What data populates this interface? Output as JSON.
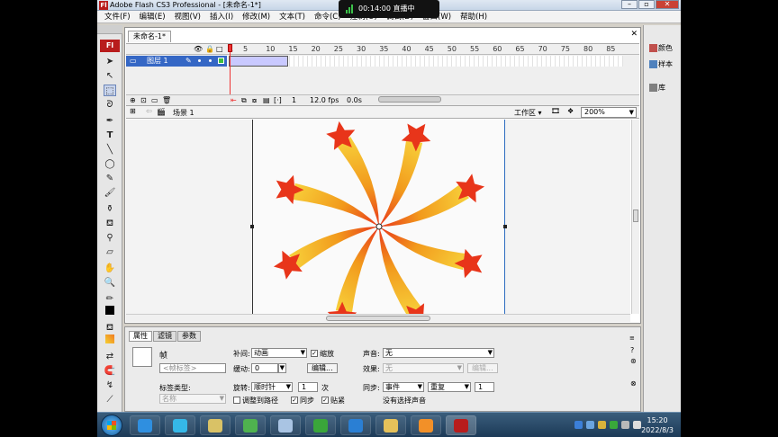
{
  "window": {
    "title": "Adobe Flash CS3 Professional - [未命名-1*]",
    "app_icon": "Fl"
  },
  "window_buttons": [
    "–",
    "▫",
    "✕"
  ],
  "live_overlay": {
    "time": "00:14:00",
    "status": "直播中",
    "accent": "#3cc24a"
  },
  "menu": [
    "文件(F)",
    "编辑(E)",
    "视图(V)",
    "插入(I)",
    "修改(M)",
    "文本(T)",
    "命令(C)",
    "控制(O)",
    "调试(D)",
    "窗口(W)",
    "帮助(H)"
  ],
  "tools": {
    "badge": "Fl"
  },
  "document": {
    "tab": "未命名-1*",
    "close": "✕",
    "timeline": {
      "frame_numbers": [
        "1",
        "5",
        "10",
        "15",
        "20",
        "25",
        "30",
        "35",
        "40",
        "45",
        "50",
        "55",
        "60",
        "65",
        "70",
        "75",
        "80",
        "85"
      ],
      "layer_name": "图层 1",
      "current_frame": "1",
      "fps": "12.0 fps",
      "time": "0.0s"
    },
    "edit_bar": {
      "scene": "场景 1",
      "workspace": "工作区",
      "zoom": "200%"
    }
  },
  "right_panels": [
    {
      "label": "颜色",
      "icon_color": "#c0504d"
    },
    {
      "label": "样本",
      "icon_color": "#4f81bd"
    },
    {
      "label": "库",
      "icon_color": "#7f7f7f"
    }
  ],
  "properties": {
    "tabs": [
      "属性",
      "滤镜",
      "参数"
    ],
    "frame_label": "帧",
    "frame_name_placeholder": "<帧标签>",
    "label_type_label": "标签类型:",
    "label_type_value": "名称",
    "tween_label": "补间:",
    "tween_value": "动画",
    "scale_label": "缩放",
    "scale_checked": true,
    "ease_label": "缓动:",
    "ease_value": "0",
    "edit_button": "编辑...",
    "rotate_label": "旋转:",
    "rotate_value": "顺时针",
    "rotate_times": "1",
    "times_unit": "次",
    "orient_label": "调整到路径",
    "orient_checked": false,
    "sync_label": "同步",
    "sync_checked": true,
    "snap_label": "贴紧",
    "snap_checked": true,
    "sound_label": "声音:",
    "sound_value": "无",
    "effect_label": "效果:",
    "effect_value": "无",
    "effect_edit_button": "编辑...",
    "sync2_label": "同步:",
    "sync_event": "事件",
    "sync_repeat": "重复",
    "repeat_count": "1",
    "no_sound_text": "没有选择声音"
  },
  "taskbar": {
    "apps": [
      {
        "name": "ie",
        "color": "#2f8fe0"
      },
      {
        "name": "ie2",
        "color": "#35b8e8"
      },
      {
        "name": "notepad",
        "color": "#d9c266"
      },
      {
        "name": "browser",
        "color": "#4fb24f"
      },
      {
        "name": "media",
        "color": "#a9c4e3"
      },
      {
        "name": "shield",
        "color": "#3aa63a"
      },
      {
        "name": "arrow-app",
        "color": "#2a7fd4"
      },
      {
        "name": "folder",
        "color": "#e5c15a"
      },
      {
        "name": "camera-app",
        "color": "#f29028"
      },
      {
        "name": "flash",
        "color": "#b81c1c"
      }
    ],
    "clock_time": "15:20",
    "clock_date": "2022/8/3"
  }
}
